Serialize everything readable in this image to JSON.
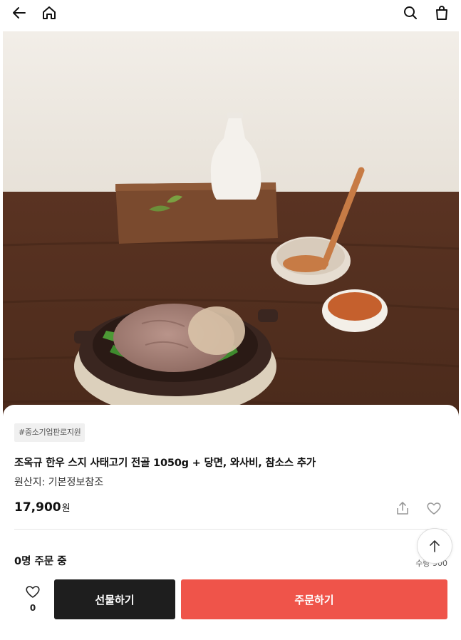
{
  "header": {
    "back_icon": "arrow-left-icon",
    "home_icon": "home-icon",
    "search_icon": "search-icon",
    "cart_icon": "shopping-bag-icon"
  },
  "product": {
    "image_alt": "",
    "tag": "#중소기업판로지원",
    "title": "조옥규 한우 스지 사태고기 전골 1050g + 당면, 와사비, 참소스 추가",
    "origin": "원산지: 기본정보참조",
    "price": "17,900",
    "price_unit": "원",
    "order_status": "0명 주문 중",
    "quantity_label": "수량 900"
  },
  "actions": {
    "like_count": "0",
    "gift_label": "선물하기",
    "order_label": "주문하기"
  },
  "colors": {
    "accent": "#ef544a",
    "dark_button": "#1e1e1e"
  }
}
